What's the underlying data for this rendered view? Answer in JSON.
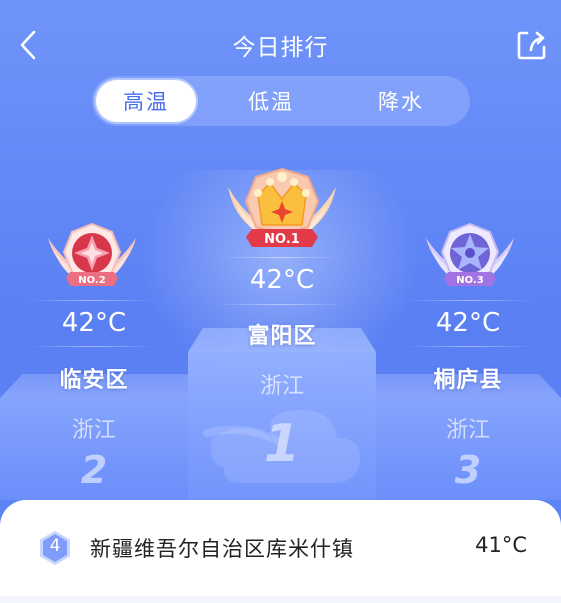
{
  "header": {
    "title": "今日排行",
    "back_icon": "chevron-left-icon",
    "share_icon": "share-icon"
  },
  "tabs": [
    {
      "label": "高温",
      "active": true
    },
    {
      "label": "低温",
      "active": false
    },
    {
      "label": "降水",
      "active": false
    }
  ],
  "podium": {
    "first": {
      "badge": "NO.1",
      "temperature": "42°C",
      "city": "富阳区",
      "province": "浙江",
      "rank": "1"
    },
    "second": {
      "badge": "NO.2",
      "temperature": "42°C",
      "city": "临安区",
      "province": "浙江",
      "rank": "2"
    },
    "third": {
      "badge": "NO.3",
      "temperature": "42°C",
      "city": "桐庐县",
      "province": "浙江",
      "rank": "3"
    }
  },
  "list": [
    {
      "rank": "4",
      "name": "新疆维吾尔自治区库米什镇",
      "temperature": "41°C"
    }
  ],
  "colors": {
    "accent": "#4a6cf0",
    "background": "#6388f6",
    "gold": "#f5b73a",
    "pink": "#ef8fa0",
    "purple": "#a89af0"
  }
}
